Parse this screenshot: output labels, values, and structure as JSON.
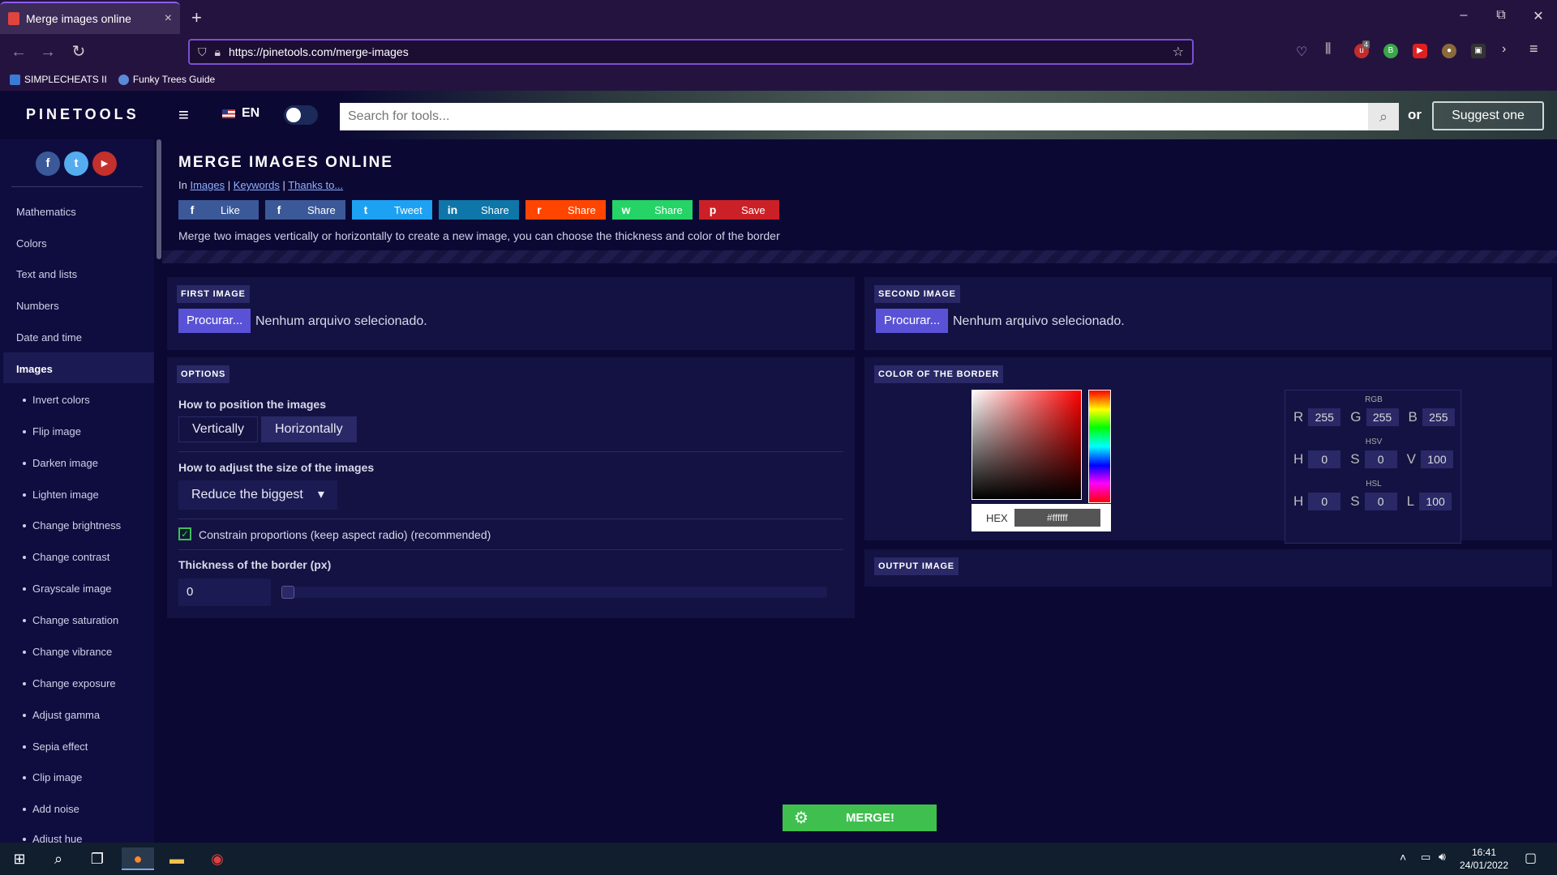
{
  "browser": {
    "tab_title": "Merge images online",
    "tab_close": "×",
    "new_tab": "+",
    "url": "https://pinetools.com/merge-images",
    "bookmarks": [
      "SIMPLECHEATS II",
      "Funky Trees Guide"
    ],
    "ext_badge": "4",
    "window_controls": [
      "–",
      "⧉",
      "✕"
    ]
  },
  "header": {
    "logo": "PINETOOLS",
    "menu_icon": "≡",
    "lang": "EN",
    "search_placeholder": "Search for tools...",
    "search_icon": "⌕",
    "or": "or",
    "suggest": "Suggest one"
  },
  "sidebar": {
    "social": [
      "f",
      "t",
      "▶"
    ],
    "categories": [
      "Mathematics",
      "Colors",
      "Text and lists",
      "Numbers",
      "Date and time",
      "Images"
    ],
    "subitems": [
      "Invert colors",
      "Flip image",
      "Darken image",
      "Lighten image",
      "Change brightness",
      "Change contrast",
      "Grayscale image",
      "Change saturation",
      "Change vibrance",
      "Change exposure",
      "Adjust gamma",
      "Sepia effect",
      "Clip image",
      "Add noise",
      "Adjust hue"
    ]
  },
  "main": {
    "title": "MERGE IMAGES ONLINE",
    "crumb_in": "In",
    "crumb_links": [
      "Images",
      "Keywords",
      "Thanks to..."
    ],
    "crumb_sep": "|",
    "share_buttons": [
      {
        "icon": "f",
        "label": "Like",
        "color": "#3b5998"
      },
      {
        "icon": "f",
        "label": "Share",
        "color": "#3b5998"
      },
      {
        "icon": "t",
        "label": "Tweet",
        "color": "#1da1f2"
      },
      {
        "icon": "in",
        "label": "Share",
        "color": "#0e76a8"
      },
      {
        "icon": "r",
        "label": "Share",
        "color": "#ff4500"
      },
      {
        "icon": "w",
        "label": "Share",
        "color": "#25d366"
      },
      {
        "icon": "p",
        "label": "Save",
        "color": "#cb2027"
      }
    ],
    "description": "Merge two images vertically or horizontally to create a new image, you can choose the thickness and color of the border"
  },
  "first_image": {
    "label": "FIRST IMAGE",
    "button": "Procurar...",
    "status": "Nenhum arquivo selecionado."
  },
  "second_image": {
    "label": "SECOND IMAGE",
    "button": "Procurar...",
    "status": "Nenhum arquivo selecionado."
  },
  "options": {
    "label": "OPTIONS",
    "position_label": "How to position the images",
    "position_options": [
      "Vertically",
      "Horizontally"
    ],
    "position_selected": "Horizontally",
    "size_label": "How to adjust the size of the images",
    "size_value": "Reduce the biggest",
    "size_caret": "▾",
    "constrain_label": "Constrain proportions (keep aspect radio) (recommended)",
    "constrain_checked": true,
    "check_mark": "✓",
    "thickness_label": "Thickness of the border (px)",
    "thickness_value": "0"
  },
  "color_border": {
    "label": "COLOR OF THE BORDER",
    "hex_label": "HEX",
    "hex_value": "#ffffff",
    "rgb_title": "RGB",
    "hsv_title": "HSV",
    "hsl_title": "HSL",
    "rgb": [
      {
        "k": "R",
        "v": "255"
      },
      {
        "k": "G",
        "v": "255"
      },
      {
        "k": "B",
        "v": "255"
      }
    ],
    "hsv": [
      {
        "k": "H",
        "v": "0"
      },
      {
        "k": "S",
        "v": "0"
      },
      {
        "k": "V",
        "v": "100"
      }
    ],
    "hsl": [
      {
        "k": "H",
        "v": "0"
      },
      {
        "k": "S",
        "v": "0"
      },
      {
        "k": "L",
        "v": "100"
      }
    ]
  },
  "output": {
    "label": "OUTPUT IMAGE"
  },
  "merge": {
    "icon": "⚙",
    "label": "MERGE!"
  },
  "taskbar": {
    "time": "16:41",
    "date": "24/01/2022"
  }
}
